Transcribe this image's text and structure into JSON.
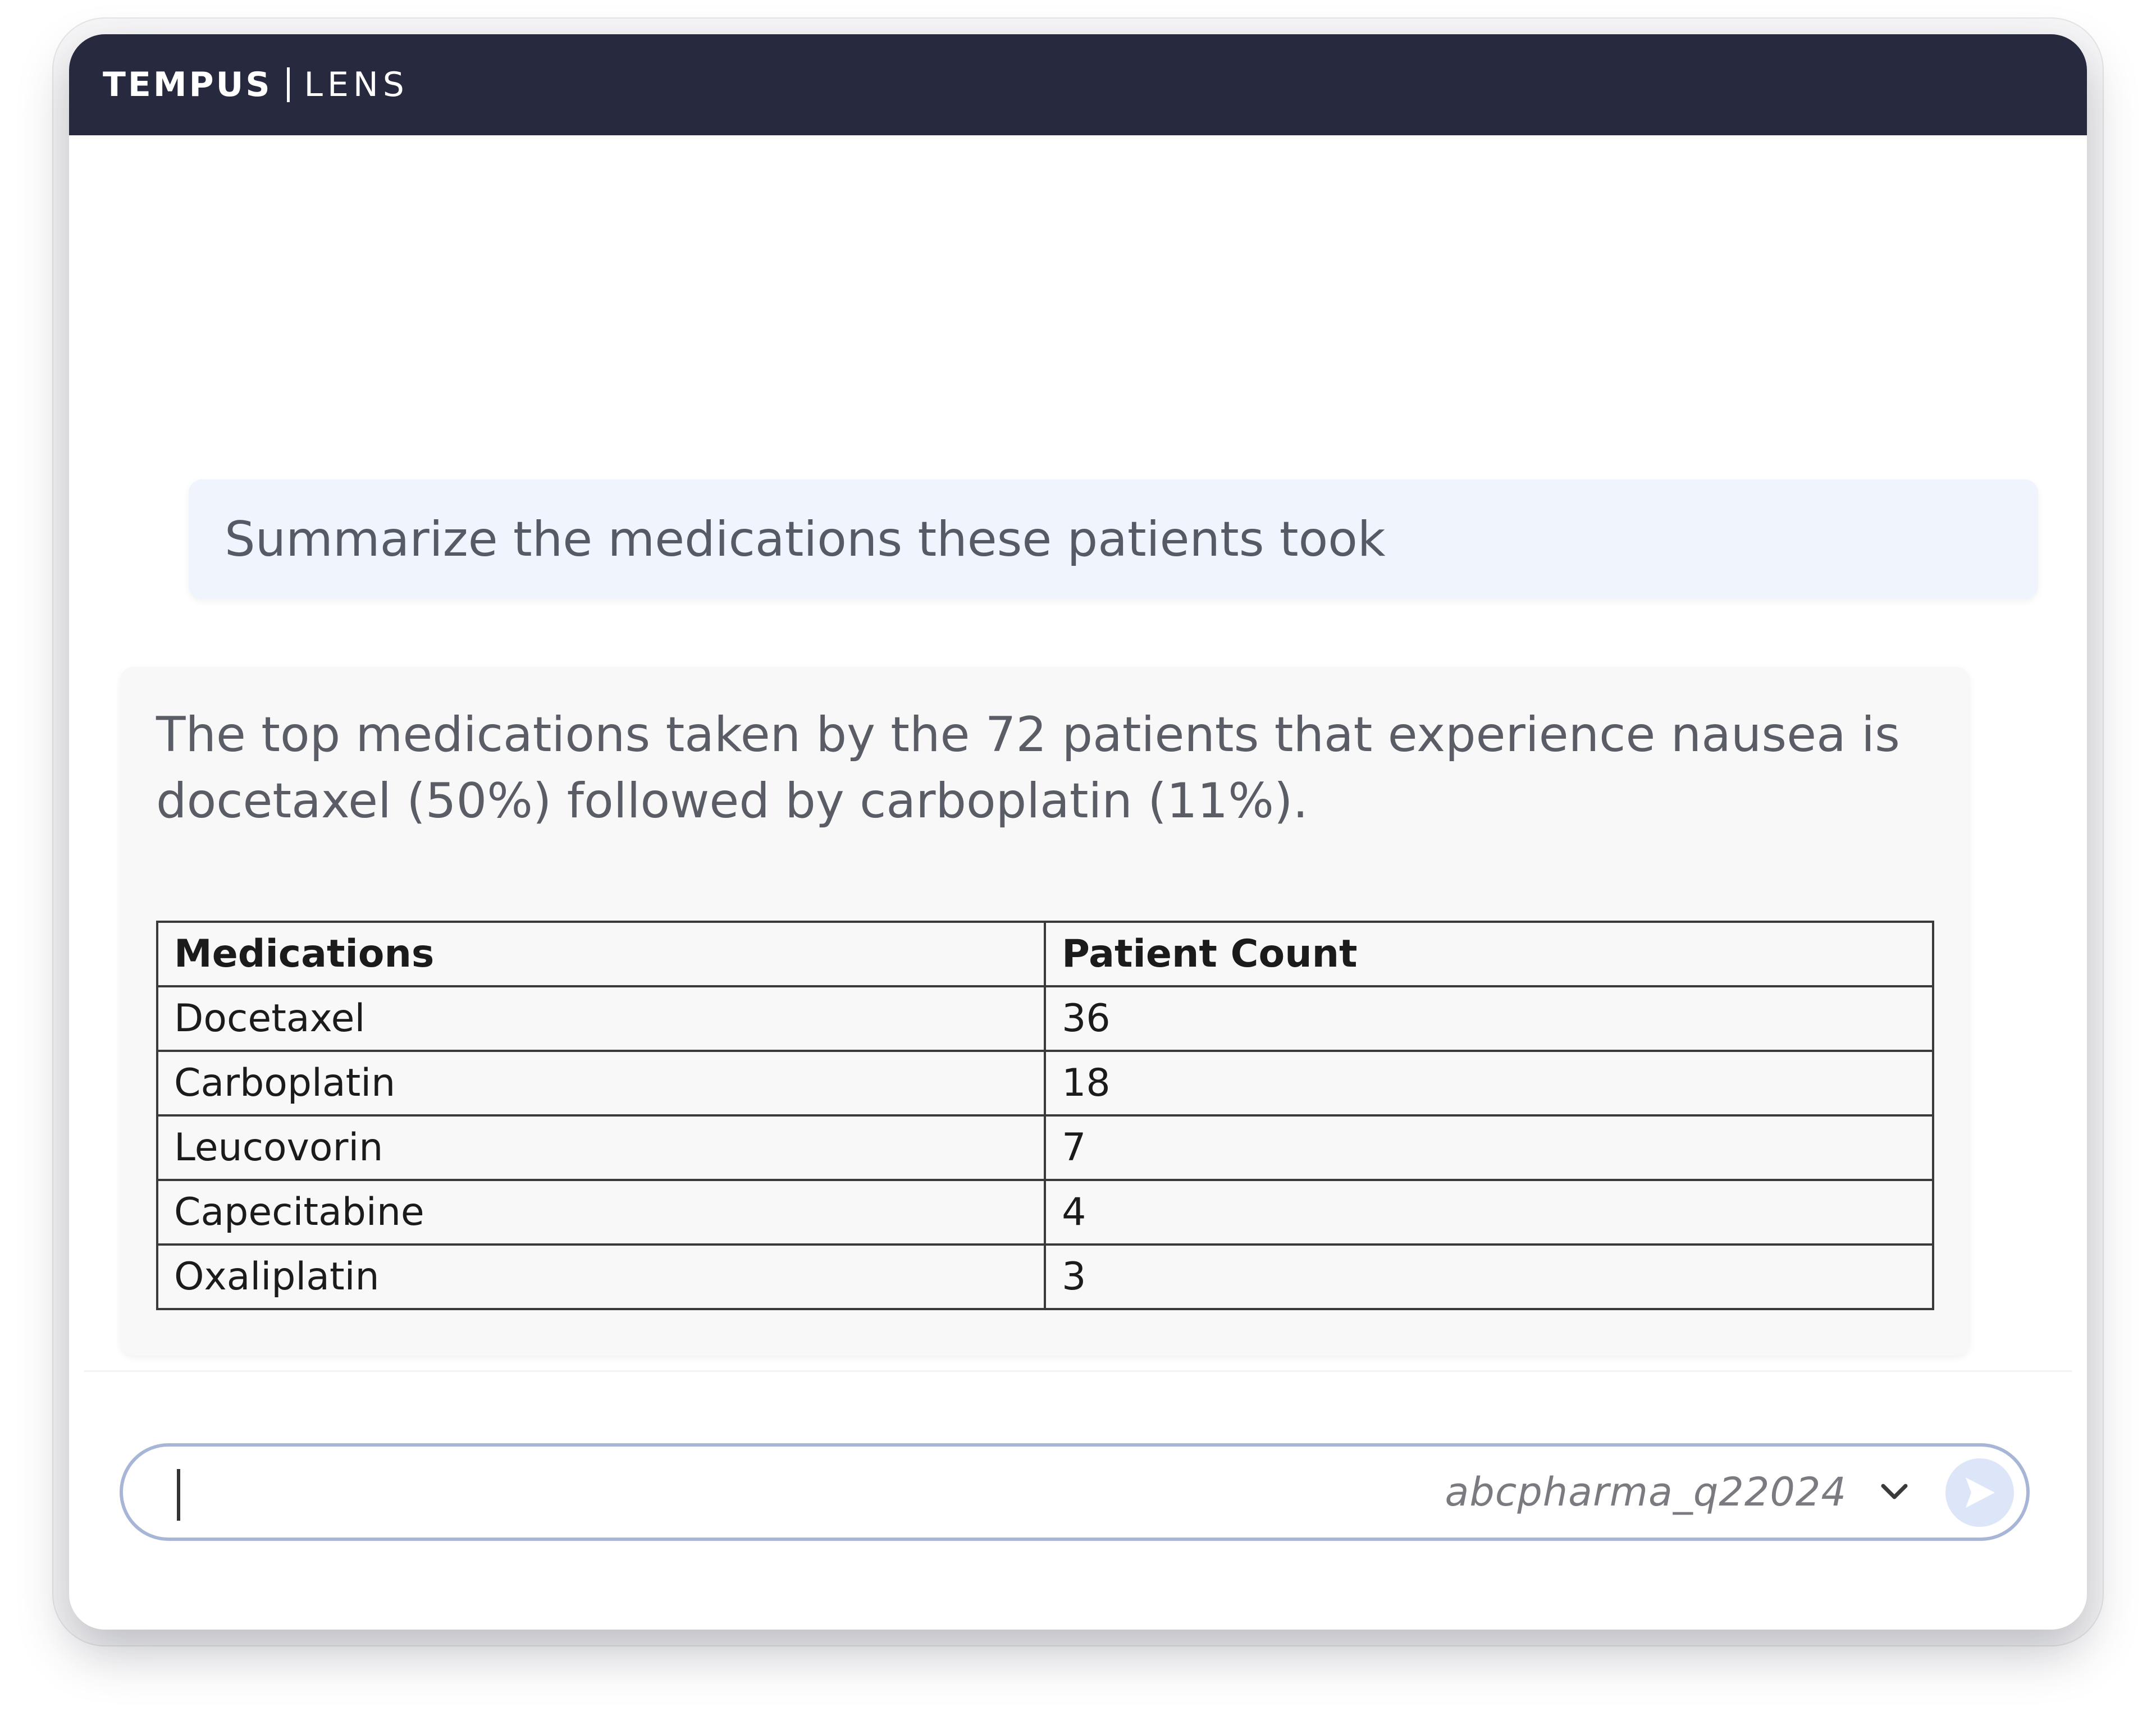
{
  "header": {
    "brand": "TEMPUS",
    "product": "LENS",
    "background_color": "#272a3f"
  },
  "conversation": {
    "user_message": "Summarize the medications these patients took",
    "assistant_message": "The top medications taken by the 72 patients that experience nausea is docetaxel (50%) followed by carboplatin (11%).",
    "table": {
      "headers": [
        "Medications",
        "Patient Count"
      ],
      "rows": [
        [
          "Docetaxel",
          "36"
        ],
        [
          "Carboplatin",
          "18"
        ],
        [
          "Leucovorin",
          "7"
        ],
        [
          "Capecitabine",
          "4"
        ],
        [
          "Oxaliplatin",
          "3"
        ]
      ]
    }
  },
  "composer": {
    "input_value": "",
    "dataset": "abcpharma_q22024",
    "icons": {
      "dropdown": "chevron-down-icon",
      "send": "send-icon"
    },
    "accent_color": "#a7b6d6"
  }
}
